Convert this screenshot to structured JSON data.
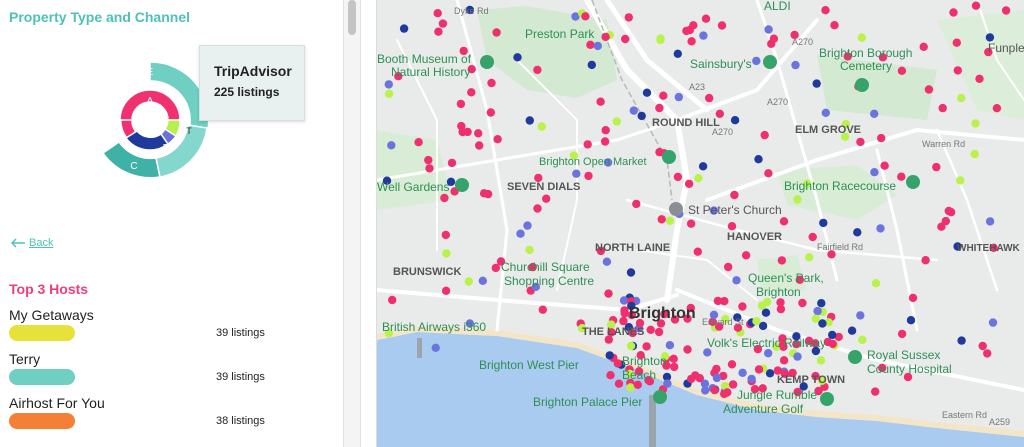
{
  "panel": {
    "title": "Property Type and Channel",
    "donut": {
      "inner_segments": [
        {
          "label": "A",
          "color": "#f0306f"
        },
        {
          "label": "B",
          "color": "#1f3a9c"
        },
        {
          "label": "V",
          "color": "#6a73d8"
        },
        {
          "label": "T",
          "color": "#b7f04a"
        }
      ],
      "outer_segments": [
        {
          "label": "E",
          "color": "#6fcfc2"
        },
        {
          "label": "C",
          "color": "#3fb1a7"
        },
        {
          "label": "P",
          "color": "#83d7cc"
        }
      ]
    },
    "tooltip": {
      "title": "TripAdvisor",
      "value": "225 listings"
    },
    "back_label": "Back",
    "hosts_title": "Top 3 Hosts",
    "hosts": [
      {
        "name": "My Getaways",
        "count": "39 listings",
        "color": "#e6e23a"
      },
      {
        "name": "Terry",
        "count": "39 listings",
        "color": "#6fcfc2"
      },
      {
        "name": "Airhost For You",
        "count": "38 listings",
        "color": "#f47f36"
      }
    ]
  },
  "map": {
    "places": [
      {
        "text": "Booth Museum of",
        "kind": "poi-green"
      },
      {
        "text": "Natural History",
        "kind": "poi-green"
      },
      {
        "text": "Preston Park",
        "kind": "poi-green"
      },
      {
        "text": "Sainsbury's",
        "kind": "poi-green"
      },
      {
        "text": "ALDI",
        "kind": "poi-green"
      },
      {
        "text": "Brighton Borough",
        "kind": "poi-green"
      },
      {
        "text": "Cemetery",
        "kind": "poi-green"
      },
      {
        "text": "Funple",
        "kind": "area"
      },
      {
        "text": "ROUND HILL",
        "kind": "district"
      },
      {
        "text": "ELM GROVE",
        "kind": "district"
      },
      {
        "text": "Brighton Open Market",
        "kind": "poi-green"
      },
      {
        "text": "SEVEN DIALS",
        "kind": "district"
      },
      {
        "text": "Well Gardens",
        "kind": "poi-green"
      },
      {
        "text": "Brighton Racecourse",
        "kind": "poi-green"
      },
      {
        "text": "St Peter's Church",
        "kind": "poi-gray"
      },
      {
        "text": "NORTH LAINE",
        "kind": "district"
      },
      {
        "text": "HANOVER",
        "kind": "district"
      },
      {
        "text": "WHITEHAWK",
        "kind": "district"
      },
      {
        "text": "BRUNSWICK",
        "kind": "district"
      },
      {
        "text": "Churchill Square",
        "kind": "poi-green"
      },
      {
        "text": "Shopping Centre",
        "kind": "poi-green"
      },
      {
        "text": "Queen's Park,",
        "kind": "poi-green"
      },
      {
        "text": "Brighton",
        "kind": "poi-green"
      },
      {
        "text": "Brighton",
        "kind": "city"
      },
      {
        "text": "British Airways i360",
        "kind": "poi-green"
      },
      {
        "text": "THE LANES",
        "kind": "district"
      },
      {
        "text": "Volk's Electric Railway",
        "kind": "poi-green"
      },
      {
        "text": "Royal Sussex",
        "kind": "poi-green"
      },
      {
        "text": "County Hospital",
        "kind": "poi-green"
      },
      {
        "text": "Brighton West Pier",
        "kind": "poi-green"
      },
      {
        "text": "Brighton",
        "kind": "poi-green"
      },
      {
        "text": "Beach",
        "kind": "poi-green"
      },
      {
        "text": "Jungle Rumble",
        "kind": "poi-green"
      },
      {
        "text": "Adventure Golf",
        "kind": "poi-green"
      },
      {
        "text": "Brighton Palace Pier",
        "kind": "poi-green"
      },
      {
        "text": "KEMP TOWN",
        "kind": "district"
      }
    ],
    "roads": [
      "A270",
      "A270",
      "A270",
      "A23",
      "A259",
      "Warren Rd",
      "Fairfield Rd",
      "Dyke Rd",
      "Edward St",
      "Eastern Rd"
    ],
    "marker_colors": {
      "pink": "#ef2f6e",
      "blue": "#6b73de",
      "navy": "#1f3a9c",
      "lime": "#b8f24a"
    }
  }
}
